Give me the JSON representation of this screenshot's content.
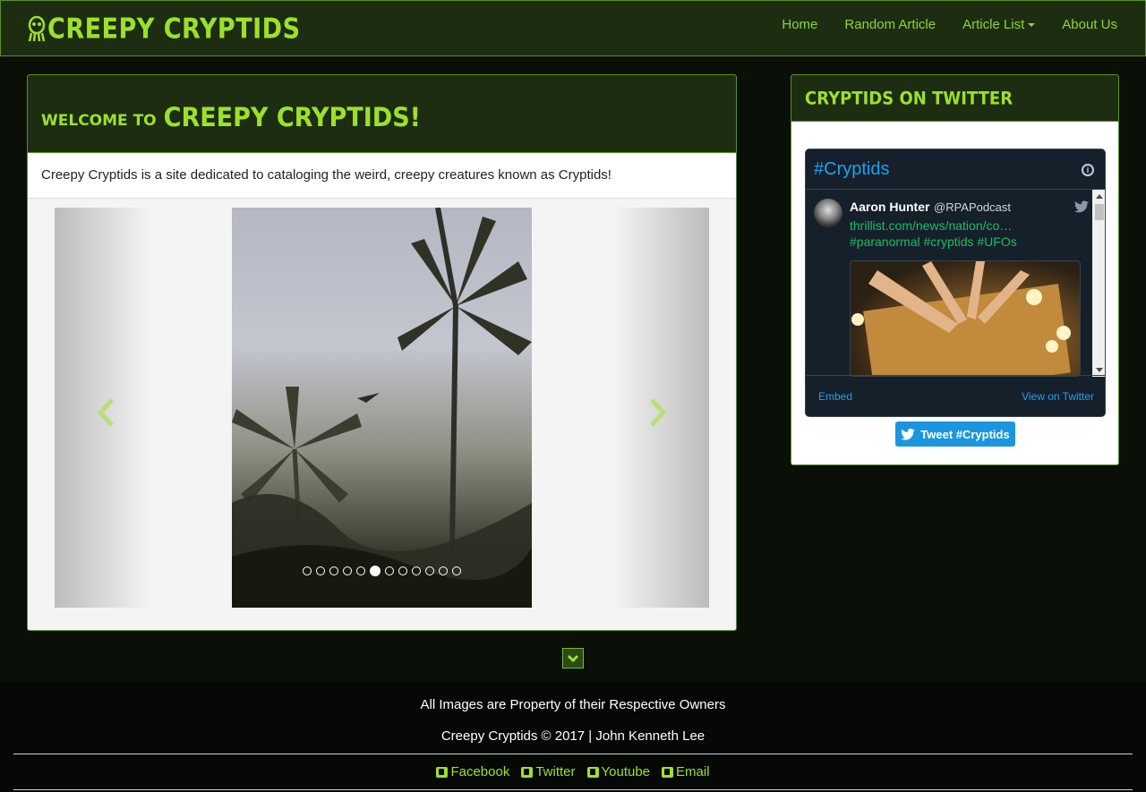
{
  "navbar": {
    "brand": "CREEPY CRYPTIDS",
    "brand_icon": "alien-icon",
    "items": [
      {
        "label": "Home"
      },
      {
        "label": "Random Article"
      },
      {
        "label": "Article List",
        "has_dropdown": true
      },
      {
        "label": "About Us"
      }
    ]
  },
  "main": {
    "welcome_small": "WELCOME TO",
    "welcome_big": "CREEPY CRYPTIDS!",
    "intro": "Creepy Cryptids is a site dedicated to cataloging the weird, creepy creatures known as Cryptids!",
    "carousel": {
      "slide_count": 12,
      "active_index": 5,
      "prev_icon": "chevron-left-icon",
      "next_icon": "chevron-right-icon"
    }
  },
  "sidebar": {
    "title": "CRYPTIDS ON TWITTER",
    "widget": {
      "hashtag": "#Cryptids",
      "tweet": {
        "name": "Aaron Hunter",
        "handle": "@RPAPodcast",
        "link": "thrillist.com/news/nation/co…",
        "tags": "#paranormal #cryptids #UFOs"
      },
      "embed_label": "Embed",
      "view_label": "View on Twitter"
    },
    "tweet_button": "Tweet #Cryptids"
  },
  "footer": {
    "line1": "All Images are Property of their Respective Owners",
    "line2": "Creepy Cryptids © 2017 | John Kenneth Lee",
    "links": [
      {
        "label": "Facebook",
        "icon": "facebook-icon"
      },
      {
        "label": "Twitter",
        "icon": "twitter-icon"
      },
      {
        "label": "Youtube",
        "icon": "youtube-icon"
      },
      {
        "label": "Email",
        "icon": "email-icon"
      }
    ]
  },
  "colors": {
    "accent": "#9de02c",
    "nav_text": "#8fd33b",
    "panel_bg": "#1d2d12",
    "page_bg": "#0a0f07",
    "twitter_blue": "#1da1f2"
  }
}
